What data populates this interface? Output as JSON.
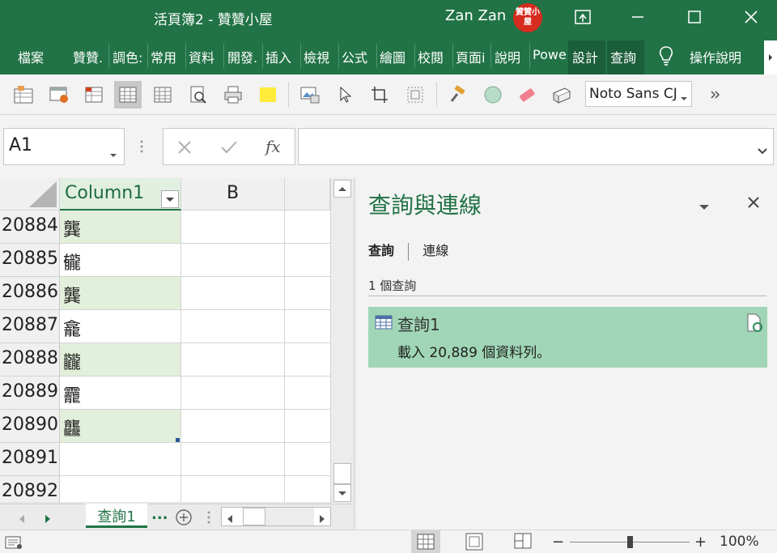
{
  "window": {
    "title": "活頁簿2  -  贊贊小屋",
    "user_name": "Zan Zan",
    "avatar_text": "贊贊小屋"
  },
  "ribbon": {
    "tabs": [
      "檔案",
      "贊贊.",
      "調色:",
      "常用",
      "資料",
      "開發.",
      "插入",
      "檢視",
      "公式",
      "繪圖",
      "校閱",
      "頁面i",
      "說明",
      "Powe",
      "設計",
      "查詢"
    ],
    "tell_me": "操作說明"
  },
  "toolbar": {
    "font_name": "Noto Sans CJ",
    "highlight_color": "#ffeb3b",
    "shape_color": "#b7dcc8"
  },
  "formula_bar": {
    "name_box": "A1",
    "fx_label": "fx",
    "formula": ""
  },
  "grid": {
    "column_a": "Column1",
    "column_b": "B",
    "rows": [
      {
        "num": "20884",
        "value": "龔"
      },
      {
        "num": "20885",
        "value": "龓"
      },
      {
        "num": "20886",
        "value": "龔"
      },
      {
        "num": "20887",
        "value": "龕"
      },
      {
        "num": "20888",
        "value": "龖"
      },
      {
        "num": "20889",
        "value": "龗"
      },
      {
        "num": "20890",
        "value": "龘"
      },
      {
        "num": "20891",
        "value": ""
      },
      {
        "num": "20892",
        "value": ""
      }
    ]
  },
  "sheets": {
    "active": "查詢1",
    "more": "..."
  },
  "query_pane": {
    "title": "查詢與連線",
    "tab_queries": "查詢",
    "tab_connections": "連線",
    "count": "1 個查詢",
    "query_name": "查詢1",
    "query_desc": "載入 20,889 個資料列。"
  },
  "status": {
    "zoom": "100%",
    "zoom_level": 0.5,
    "accent": "#217346"
  }
}
